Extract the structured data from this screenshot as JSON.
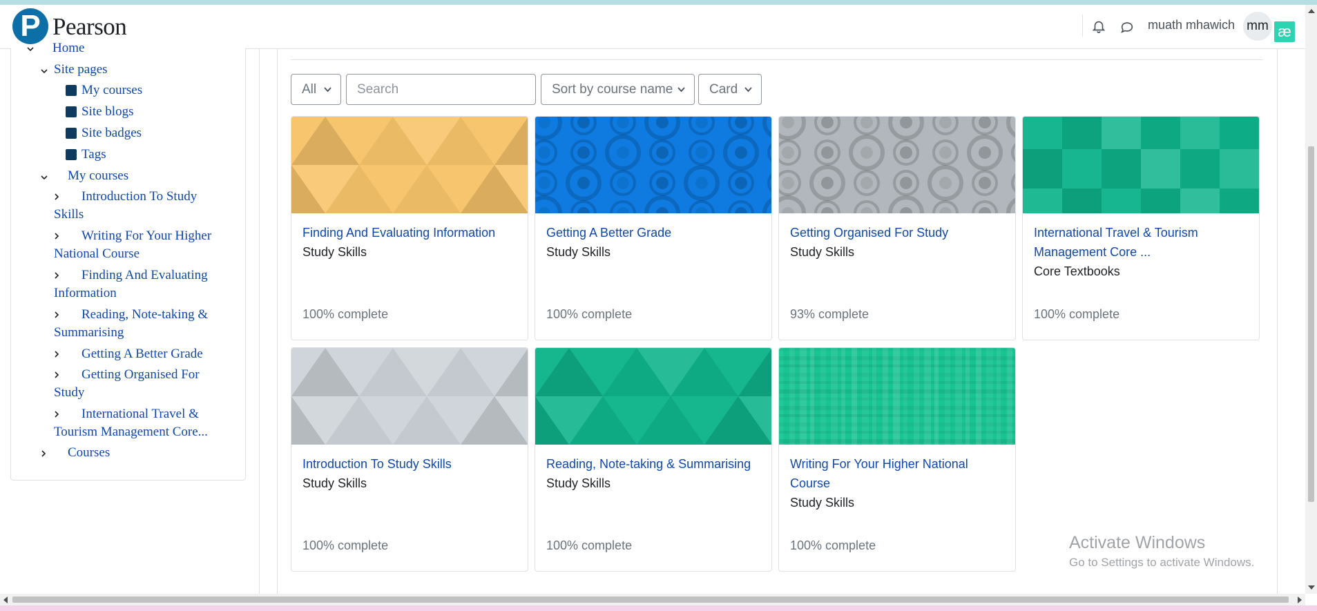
{
  "brand": {
    "logo_letter": "P",
    "name": "Pearson"
  },
  "header": {
    "username": "muath mhawich",
    "avatar_initials": "mm",
    "badge": "æ"
  },
  "sidebar": {
    "home": "Home",
    "site_pages": "Site pages",
    "site_items": [
      "My courses",
      "Site blogs",
      "Site badges",
      "Tags"
    ],
    "my_courses": "My courses",
    "courses": [
      [
        "Introduction To Study",
        "Skills"
      ],
      [
        "Writing For Your Higher",
        "National Course"
      ],
      [
        "Finding And Evaluating",
        "Information"
      ],
      [
        "Reading, Note-taking &",
        "Summarising"
      ],
      [
        "Getting A Better Grade",
        ""
      ],
      [
        "Getting Organised For",
        "Study"
      ],
      [
        "International Travel &",
        "Tourism Management Core..."
      ]
    ],
    "courses_root": "Courses"
  },
  "controls": {
    "filter": "All",
    "search_placeholder": "Search",
    "sort": "Sort by course name",
    "view": "Card"
  },
  "cards": [
    {
      "title": "Finding And Evaluating Information",
      "category": "Study Skills",
      "progress": "100% complete",
      "pattern": "triangles",
      "color": "#f8c46b"
    },
    {
      "title": "Getting A Better Grade",
      "category": "Study Skills",
      "progress": "100% complete",
      "pattern": "circles",
      "color": "#0f7be0"
    },
    {
      "title": "Getting Organised For Study",
      "category": "Study Skills",
      "progress": "93% complete",
      "pattern": "circles",
      "color": "#b1b7bc"
    },
    {
      "title": "International Travel & Tourism Management Core ...",
      "category": "Core Textbooks",
      "progress": "100% complete",
      "pattern": "squares",
      "color": "#0fb48c"
    },
    {
      "title": "Introduction To Study Skills",
      "category": "Study Skills",
      "progress": "100% complete",
      "pattern": "triangles",
      "color": "#ced4da"
    },
    {
      "title": "Reading, Note-taking & Summarising",
      "category": "Study Skills",
      "progress": "100% complete",
      "pattern": "triangles",
      "color": "#0fb48c"
    },
    {
      "title": "Writing For Your Higher National Course",
      "category": "Study Skills",
      "progress": "100% complete",
      "pattern": "plaid",
      "color": "#19c493"
    }
  ],
  "watermark": {
    "line1": "Activate Windows",
    "line2": "Go to Settings to activate Windows."
  }
}
